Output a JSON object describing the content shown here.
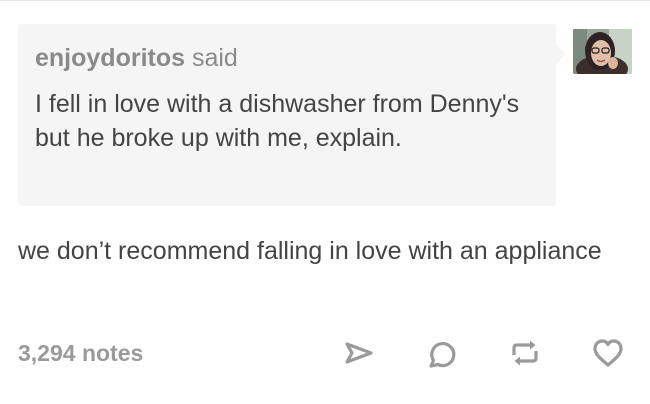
{
  "ask": {
    "asker_name": "enjoydoritos",
    "said_label": "said",
    "question": "I fell in love with a dishwasher from Denny's but he broke up with me, explain."
  },
  "answer": {
    "text": "we don’t recommend falling in love with an appliance"
  },
  "footer": {
    "notes": "3,294 notes",
    "actions": [
      "share-icon",
      "reply-icon",
      "reblog-icon",
      "like-icon"
    ]
  },
  "colors": {
    "bubble_bg": "#f5f5f5",
    "text": "#444444",
    "muted": "#9a9a9a"
  }
}
